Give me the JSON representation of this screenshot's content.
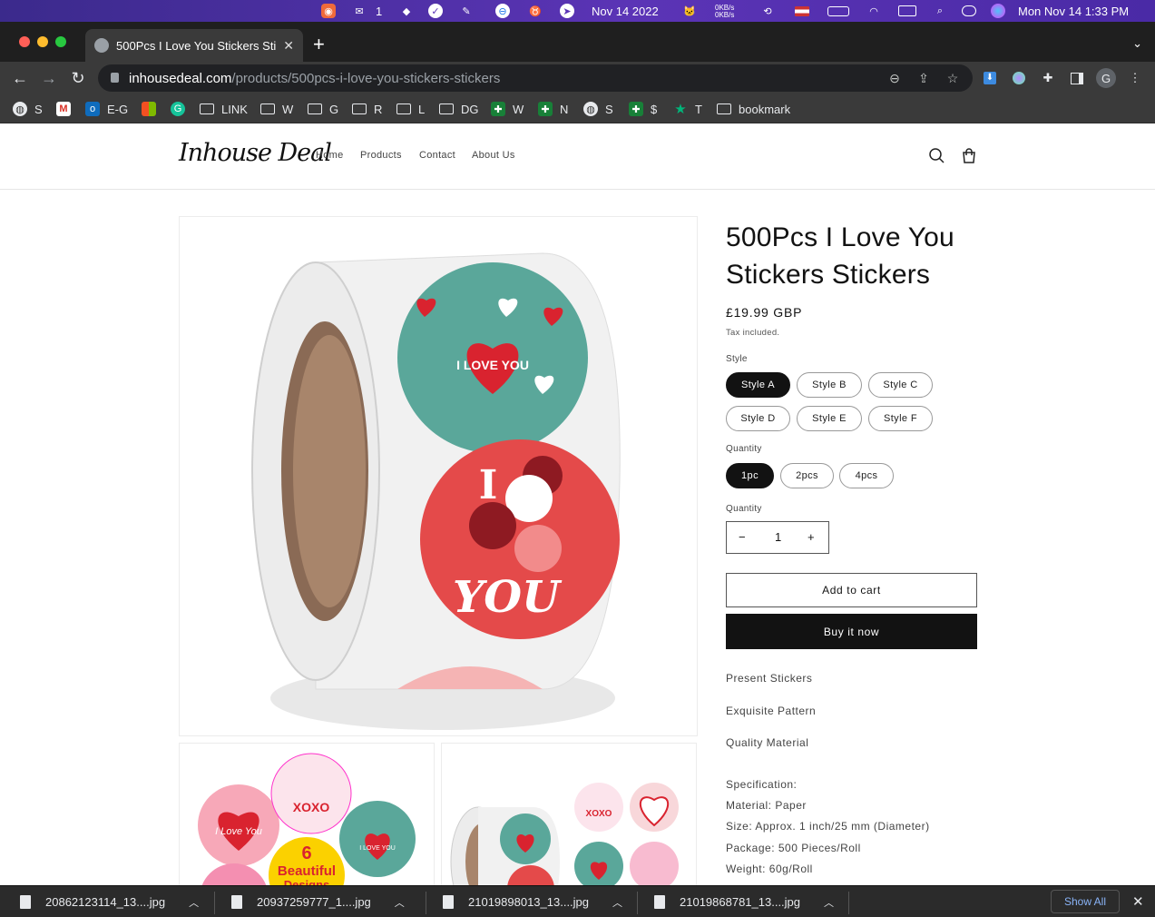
{
  "menubar": {
    "wechat_count": "1",
    "date": "Nov 14 2022",
    "net_up": "0KB/s",
    "net_down": "0KB/s",
    "clock": "Mon Nov 14  1:33 PM"
  },
  "browser": {
    "tab_title": "500Pcs I Love You Stickers Stickers",
    "url_host": "inhousedeal.com",
    "url_path": "/products/500pcs-i-love-you-stickers-stickers",
    "profile_initial": "G",
    "bookmarks": [
      {
        "label": "S",
        "icon": "globe-icon"
      },
      {
        "label": "",
        "icon": "gmail-icon"
      },
      {
        "label": "E-G",
        "icon": "outlook-icon"
      },
      {
        "label": "",
        "icon": "microsoft-icon"
      },
      {
        "label": "",
        "icon": "grammarly-icon"
      },
      {
        "label": "LINK",
        "icon": "folder-icon"
      },
      {
        "label": "W",
        "icon": "folder-icon"
      },
      {
        "label": "G",
        "icon": "folder-icon"
      },
      {
        "label": "R",
        "icon": "folder-icon"
      },
      {
        "label": "L",
        "icon": "folder-icon"
      },
      {
        "label": "DG",
        "icon": "folder-icon"
      },
      {
        "label": "W",
        "icon": "sheets-icon"
      },
      {
        "label": "N",
        "icon": "sheets-icon"
      },
      {
        "label": "S",
        "icon": "globe-icon"
      },
      {
        "label": "$",
        "icon": "sheets-icon"
      },
      {
        "label": "T",
        "icon": "star-icon"
      },
      {
        "label": "bookmark",
        "icon": "folder-icon"
      }
    ]
  },
  "site": {
    "logo": "Inhouse Deal",
    "nav": [
      "Home",
      "Products",
      "Contact",
      "About Us"
    ]
  },
  "product": {
    "title": "500Pcs I Love You Stickers Stickers",
    "price": "£19.99 GBP",
    "tax_note": "Tax included.",
    "style_label": "Style",
    "styles": [
      "Style A",
      "Style B",
      "Style C",
      "Style D",
      "Style E",
      "Style F"
    ],
    "selected_style": "Style A",
    "pack_label": "Quantity",
    "packs": [
      "1pc",
      "2pcs",
      "4pcs"
    ],
    "selected_pack": "1pc",
    "qty_label": "Quantity",
    "qty_value": "1",
    "add_to_cart": "Add to cart",
    "buy_now": "Buy it now",
    "features": [
      "Present Stickers",
      "Exquisite Pattern",
      "Quality Material"
    ],
    "spec_heading": "Specification:",
    "specs": [
      "Material: Paper",
      "Size: Approx. 1 inch/25 mm (Diameter)",
      "Package: 500 Pieces/Roll",
      "Weight: 60g/Roll"
    ],
    "image_text": {
      "main_sticker_1": "I LOVE YOU",
      "main_sticker_2a": "I",
      "main_sticker_2b": "YOU",
      "thumb1_a": "I Love You",
      "thumb1_b": "XOXO",
      "thumb1_c": "6",
      "thumb1_d": "Beautiful",
      "thumb1_e": "Designs",
      "thumb2_a": "XOXO",
      "thumb2_b": "I LOVE YOU"
    }
  },
  "downloads": {
    "items": [
      "20862123114_13....jpg",
      "20937259777_1....jpg",
      "21019898013_13....jpg",
      "21019868781_13....jpg"
    ],
    "show_all": "Show All"
  },
  "colors": {
    "menubar": "#4a2aa6",
    "chrome_dark": "#3a3a3a",
    "accent_black": "#121212",
    "teal_sticker": "#5aa79a",
    "red_sticker": "#e44a4a"
  }
}
